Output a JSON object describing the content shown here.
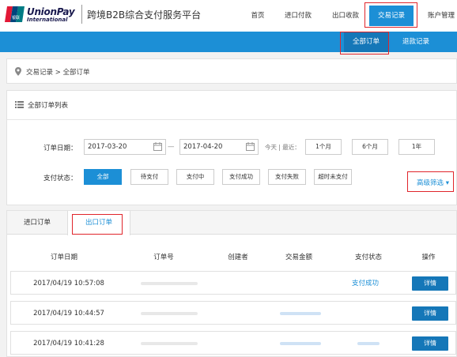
{
  "header": {
    "logo_main": "UnionPay",
    "logo_sub": "International",
    "logo_cn": "银联",
    "site_title": "跨境B2B综合支付服务平台",
    "nav": [
      {
        "label": "首页"
      },
      {
        "label": "进口付款"
      },
      {
        "label": "出口收款"
      },
      {
        "label": "交易记录",
        "active": true
      },
      {
        "label": "账户管理"
      }
    ]
  },
  "subnav": {
    "items": [
      {
        "label": "全部订单",
        "active": true
      },
      {
        "label": "退款记录"
      }
    ]
  },
  "breadcrumb": {
    "text": "交易记录 > 全部订单"
  },
  "filter": {
    "title": "全部订单列表",
    "date_label": "订单日期：",
    "date_from": "2017-03-20",
    "date_sep": "—",
    "date_to": "2017-04-20",
    "quick_label": "今天 | 最近：",
    "quick_ranges": [
      "1个月",
      "6个月",
      "1年"
    ],
    "status_label": "支付状态：",
    "statuses": [
      "全部",
      "待支付",
      "支付中",
      "支付成功",
      "支付失败",
      "超时未支付"
    ],
    "advanced_label": "高级筛选"
  },
  "tabs": [
    "进口订单",
    "出口订单"
  ],
  "table": {
    "headers": [
      "订单日期",
      "订单号",
      "创建者",
      "交易金额",
      "支付状态",
      "操作"
    ],
    "rows": [
      {
        "date": "2017/04/19 10:57:08",
        "status": "支付成功",
        "action": "详情"
      },
      {
        "date": "2017/04/19 10:44:57",
        "status": "",
        "action": "详情"
      },
      {
        "date": "2017/04/19 10:41:28",
        "status": "",
        "action": "详情"
      }
    ]
  },
  "colors": {
    "primary": "#1c8fd6",
    "primary_dark": "#1577b8",
    "highlight": "#e0252b"
  }
}
